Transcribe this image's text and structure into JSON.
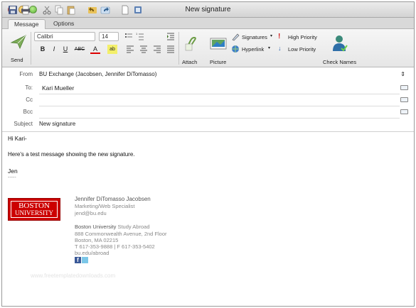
{
  "window": {
    "title": "New signature"
  },
  "tabs": [
    {
      "label": "Message"
    },
    {
      "label": "Options"
    }
  ],
  "ribbon": {
    "send_label": "Send",
    "font_name": "Calibri",
    "font_size": "14",
    "attach_label": "Attach",
    "picture_label": "Picture",
    "signatures_label": "Signatures",
    "hyperlink_label": "Hyperlink",
    "high_priority_label": "High Priority",
    "low_priority_label": "Low Priority",
    "check_names_label": "Check Names",
    "bold": "B",
    "italic": "I",
    "underline": "U",
    "strike": "ABC",
    "font_color": "A"
  },
  "header": {
    "from_label": "From",
    "from_value": "BU Exchange (Jacobsen, Jennifer DiTomasso)",
    "to_label": "To:",
    "to_value": "Kari Mueller",
    "cc_label": "Cc",
    "bcc_label": "Bcc",
    "subject_label": "Subject",
    "subject_value": "New signature"
  },
  "body": {
    "greeting": "Hi Kari-",
    "line1": "Here's a test message showing the new signature.",
    "signoff": "Jen",
    "dashes": "-----"
  },
  "signature": {
    "logo_line1": "BOSTON",
    "logo_line2": "UNIVERSITY",
    "name": "Jennifer DiTomasso Jacobsen",
    "title": "Marketing/Web Specialist",
    "email": "jend@bu.edu",
    "org_bold": "Boston University",
    "org_rest": "Study Abroad",
    "address1": "888 Commonwealth Avenue, 2nd Floor",
    "address2": "Boston, MA 02215",
    "phone": "T 617-353-9888 | F 617-353-5402",
    "web": "bu.edu/abroad"
  },
  "watermark": "www.freetemplatedownloads.com",
  "colors": {
    "logo_red": "#cc0000",
    "facebook_blue": "#3b5998",
    "title_text": "#222222"
  }
}
